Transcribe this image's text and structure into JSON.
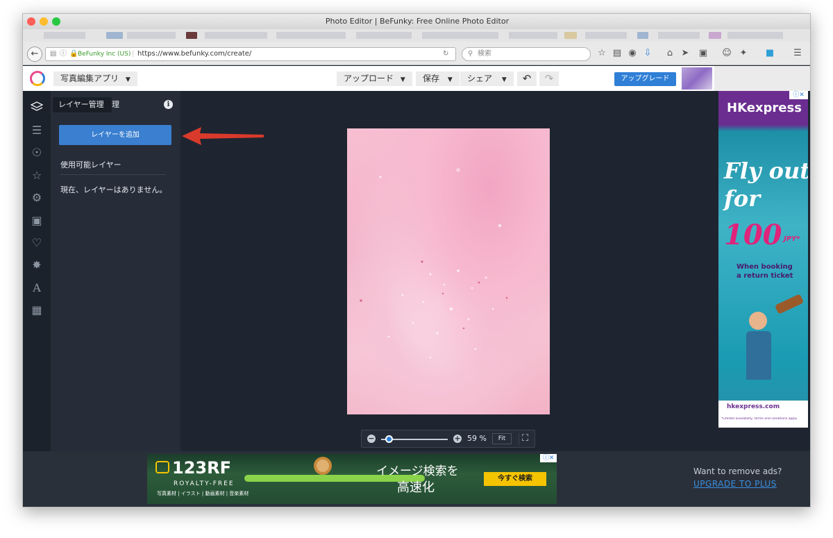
{
  "browser": {
    "window_title": "Photo Editor | BeFunky: Free Online Photo Editor",
    "site_identity": "BeFunky Inc (US)",
    "url": "https://www.befunky.com/create/",
    "search_placeholder": "検索"
  },
  "app": {
    "mode_label": "写真編集アプリ",
    "upload_label": "アップロード",
    "save_label": "保存",
    "share_label": "シェア",
    "upgrade_label": "アップグレード"
  },
  "panel": {
    "tooltip": "レイヤー管理",
    "title_tail": "理",
    "add_layer_label": "レイヤーを追加",
    "available_heading": "使用可能レイヤー",
    "empty_message": "現在、レイヤーはありません。"
  },
  "zoom": {
    "percent_label": "59 %",
    "fit_label": "Fit",
    "level": 0.59
  },
  "ad_right": {
    "brand": "HKexpress",
    "headline_1": "Fly out",
    "headline_2": "for",
    "price": "100",
    "currency": "JPY*",
    "sub_1": "When booking",
    "sub_2": "a return ticket",
    "site": "hkexpress.com",
    "fine_print": "*Limited availability, terms and conditions apply"
  },
  "ad_bottom": {
    "brand": "123RF",
    "tagline": "ROYALTY-FREE",
    "categories": "写真素材 | イラスト | 動画素材 | 音楽素材",
    "headline_1": "イメージ検索を",
    "headline_2": "高速化",
    "cta": "今すぐ検索"
  },
  "remove_ads": {
    "question": "Want to remove ads?",
    "link": "UPGRADE TO PLUS"
  },
  "icons": {
    "back": "back-arrow-icon",
    "layers": "layers-icon",
    "adjust": "sliders-icon",
    "eye": "eye-icon",
    "star": "star-icon",
    "gear": "gear-icon",
    "frame": "frame-icon",
    "heart": "heart-icon",
    "badge": "badge-icon",
    "text": "text-icon",
    "texture": "texture-icon"
  },
  "colors": {
    "accent_blue": "#2f7fd6",
    "sidebar_bg": "#1c222b",
    "panel_bg": "#262d39",
    "canvas_bg": "#1e2530",
    "arrow_red": "#d93a2b"
  }
}
